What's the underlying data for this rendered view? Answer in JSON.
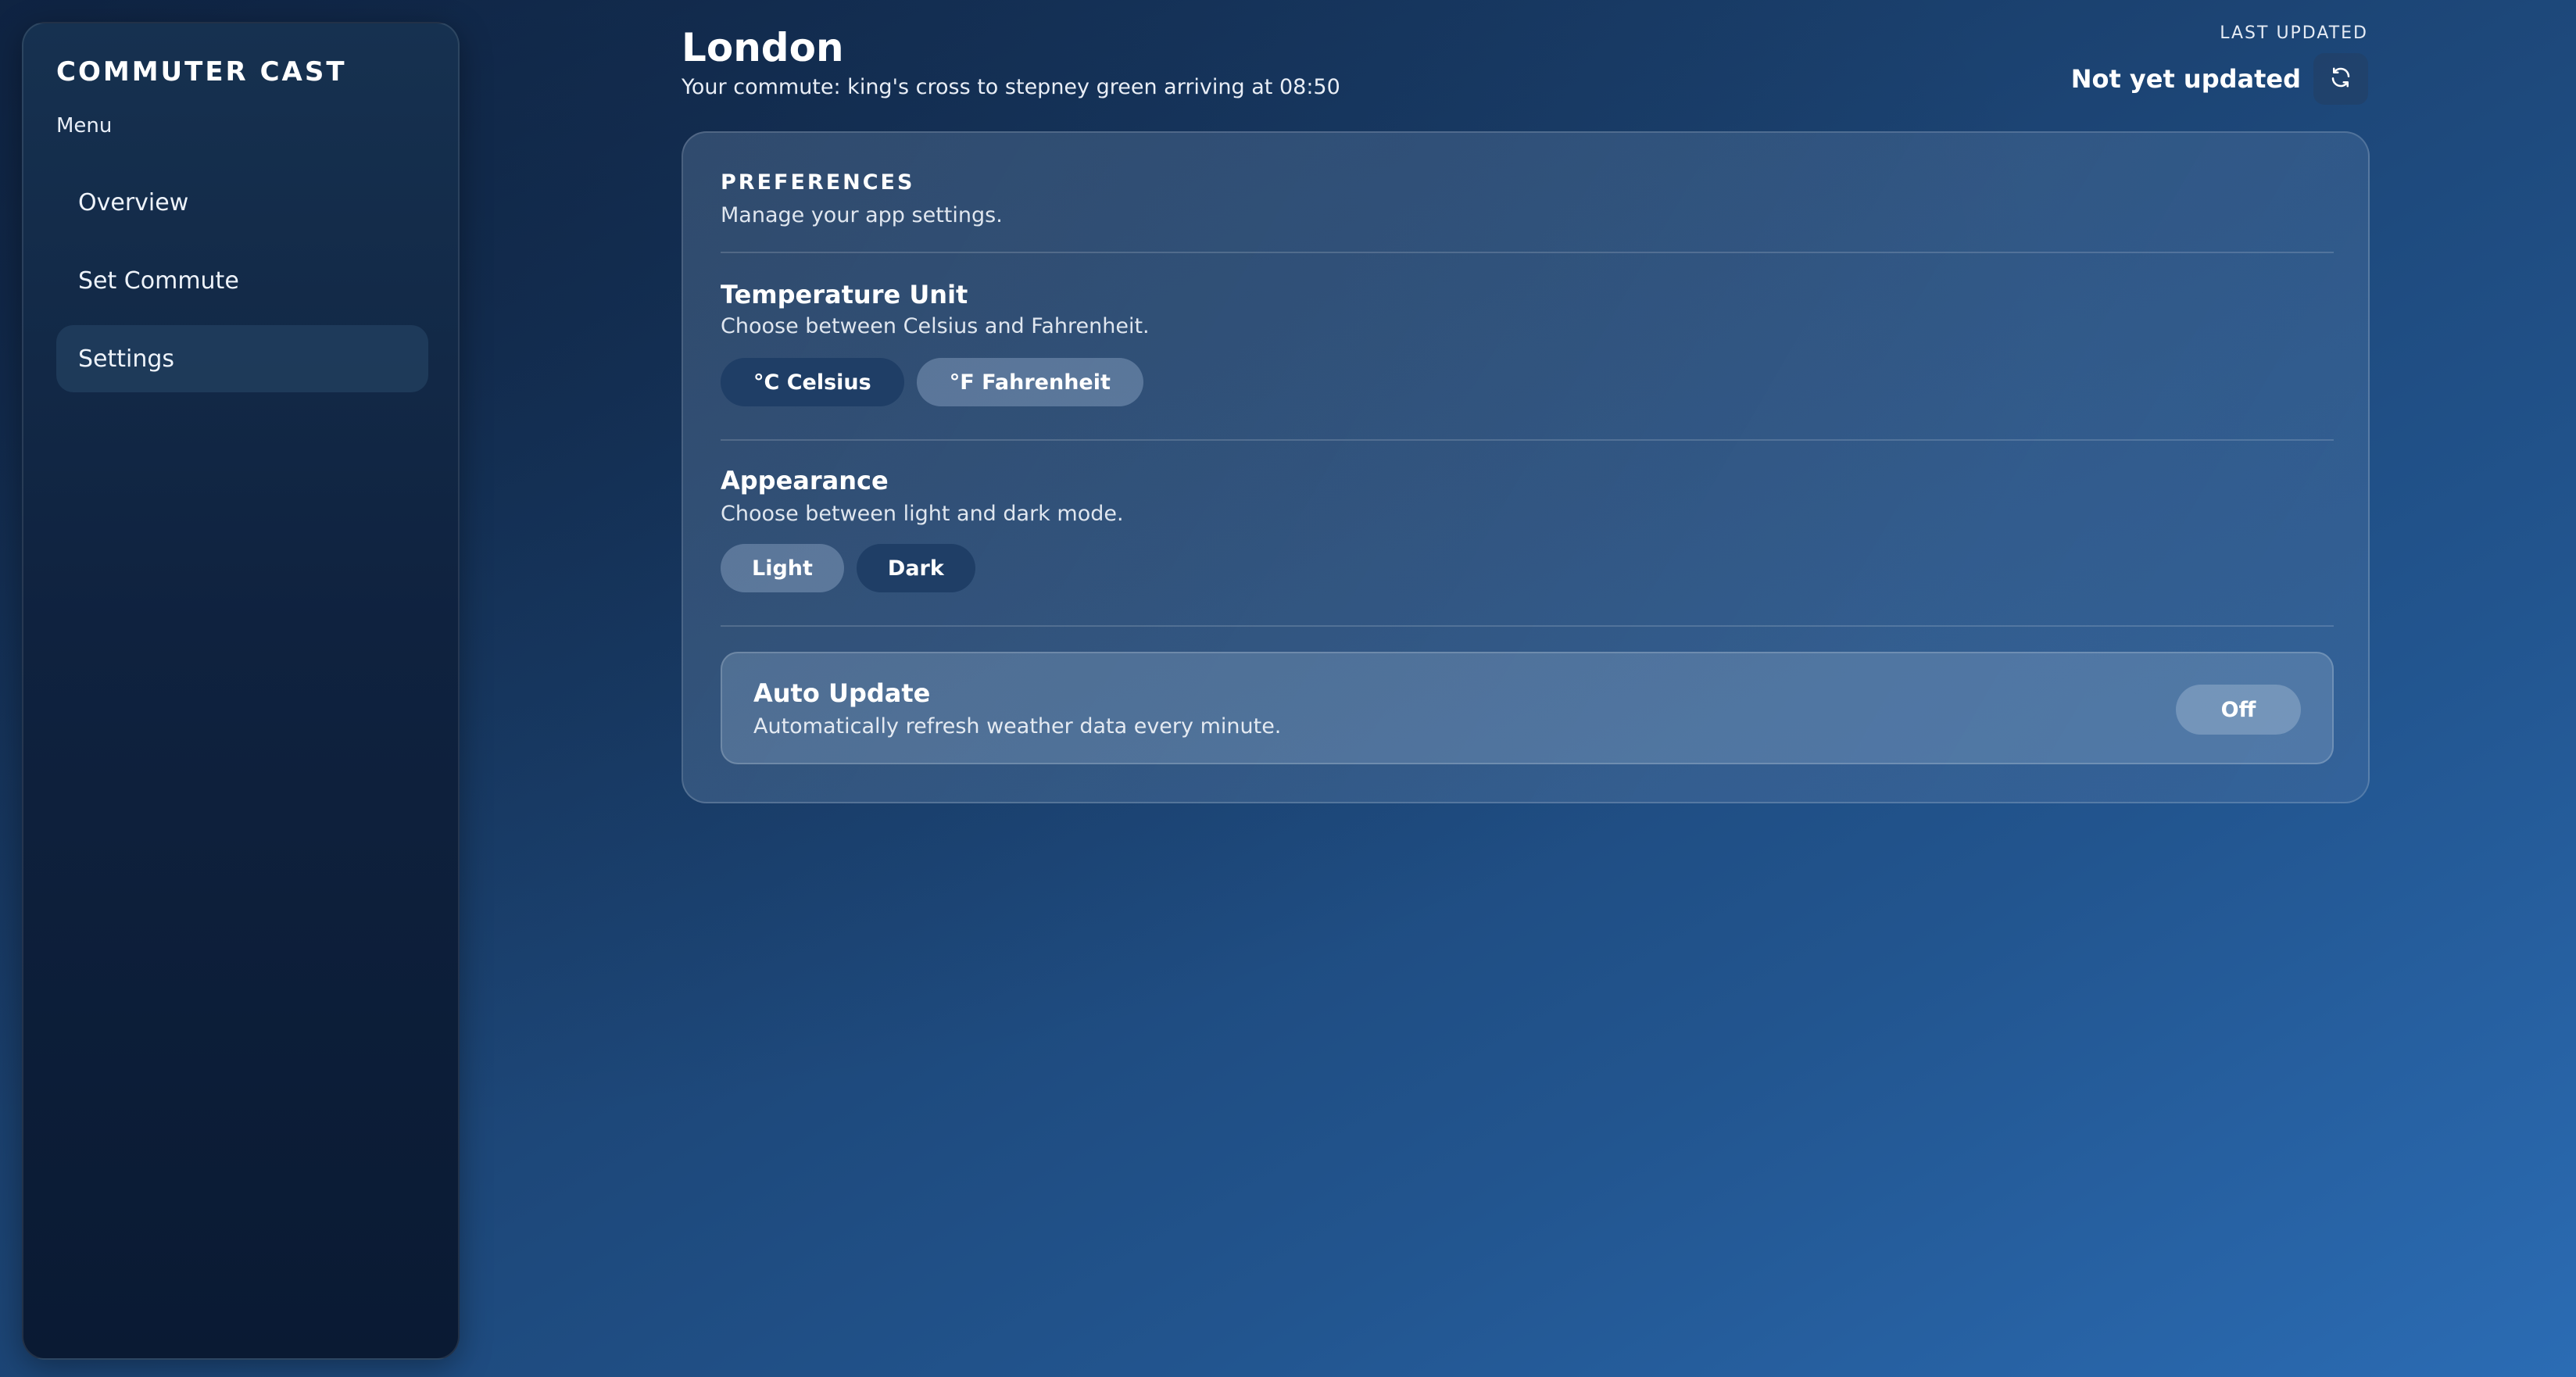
{
  "app": {
    "brand": "COMMUTER CAST",
    "menu_label": "Menu"
  },
  "sidebar": {
    "items": [
      {
        "label": "Overview",
        "active": false
      },
      {
        "label": "Set Commute",
        "active": false
      },
      {
        "label": "Settings",
        "active": true
      }
    ]
  },
  "header": {
    "city": "London",
    "commute": "Your commute: king's cross to stepney green arriving at 08:50",
    "last_updated_label": "LAST UPDATED",
    "last_updated_value": "Not yet updated",
    "refresh_icon": "refresh-icon"
  },
  "preferences": {
    "title": "PREFERENCES",
    "subtitle": "Manage your app settings.",
    "temperature": {
      "title": "Temperature Unit",
      "description": "Choose between Celsius and Fahrenheit.",
      "options": [
        "°C Celsius",
        "°F Fahrenheit"
      ],
      "selected": "°C Celsius"
    },
    "appearance": {
      "title": "Appearance",
      "description": "Choose between light and dark mode.",
      "options": [
        "Light",
        "Dark"
      ],
      "selected": "Dark"
    },
    "auto_update": {
      "title": "Auto Update",
      "description": "Automatically refresh weather data every minute.",
      "state": "Off"
    }
  },
  "colors": {
    "background_start": "#11284a",
    "background_end": "#2b6cb4",
    "selected_pill": "#1f3e66"
  }
}
